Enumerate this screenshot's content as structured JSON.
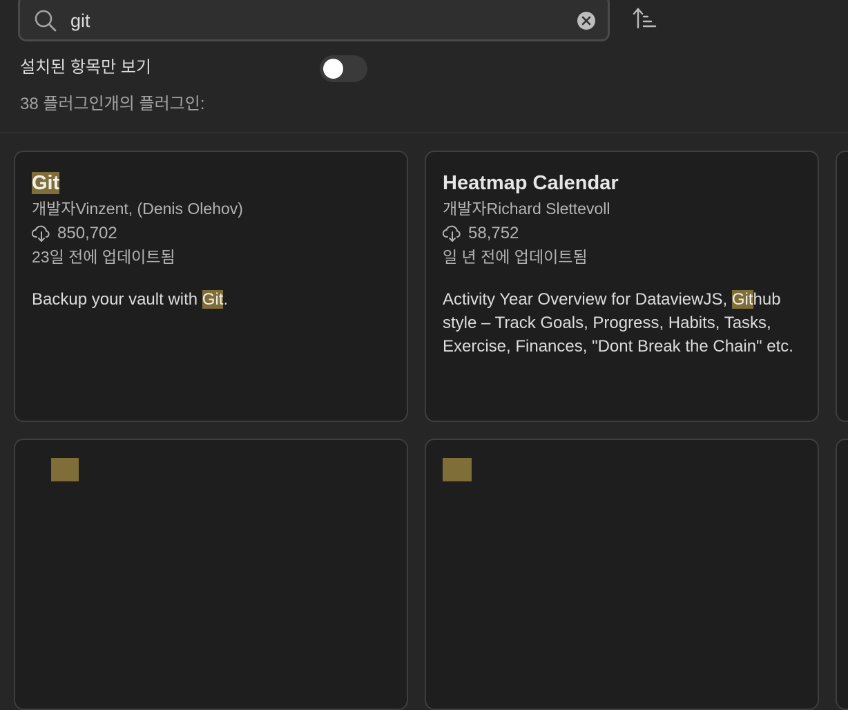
{
  "search": {
    "value": "git"
  },
  "filter": {
    "installed_only_label": "설치된 항목만 보기",
    "installed_only_on": false
  },
  "result_count_label": "38 플러그인개의 플러그인:",
  "colors": {
    "highlight": "#7f6e37",
    "card_bg": "#1e1e1e",
    "page_bg": "#262626"
  },
  "plugins": [
    {
      "title_hl": "Git",
      "title_rest": "",
      "author": "개발자Vinzent, (Denis Olehov)",
      "downloads": "850,702",
      "updated": "23일 전에 업데이트됨",
      "desc_before": "Backup your vault with ",
      "desc_hl": "Git",
      "desc_after": "."
    },
    {
      "title_hl": "",
      "title_rest": "Heatmap Calendar",
      "author": "개발자Richard Slettevoll",
      "downloads": "58,752",
      "updated": "일 년 전에 업데이트됨",
      "desc_before": "Activity Year Overview for DataviewJS, ",
      "desc_hl": "Git",
      "desc_after": "hub style – Track Goals, Progress, Habits, Tasks, Exercise, Finances, \"Dont Break the Chain\" etc."
    }
  ]
}
